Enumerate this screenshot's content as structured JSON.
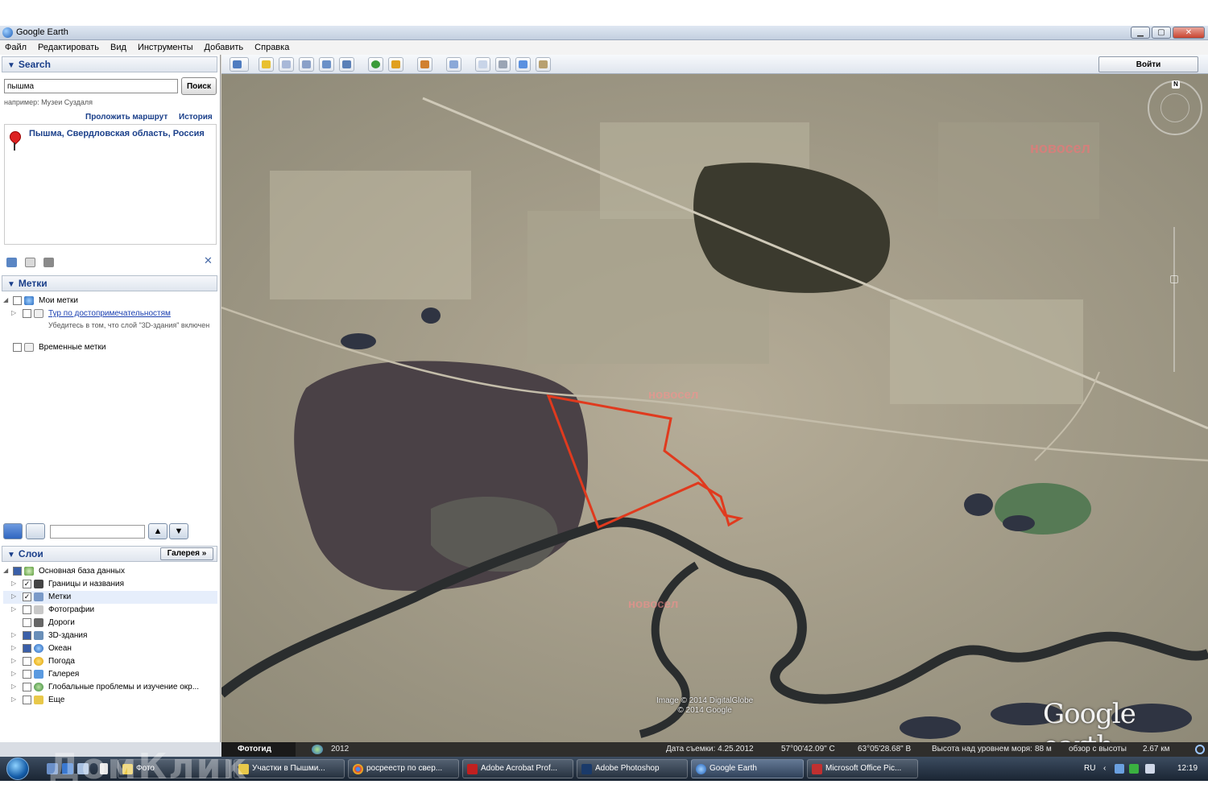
{
  "window": {
    "title": "Google Earth",
    "buttons": [
      "▁",
      "▢",
      "✕"
    ]
  },
  "menu": [
    "Файл",
    "Редактировать",
    "Вид",
    "Инструменты",
    "Добавить",
    "Справка"
  ],
  "search": {
    "header": "Search",
    "value": "пышма",
    "button": "Поиск",
    "hint": "например: Музеи Суздаля",
    "route_link": "Проложить маршрут",
    "history_link": "История",
    "result": "Пышма, Свердловская область, Россия"
  },
  "places": {
    "header": "Метки",
    "my_places": "Мои метки",
    "tour": "Тур по достопримечательностям",
    "tour_note": "Убедитесь в том, что слой \"3D-здания\" включен",
    "temp": "Временные метки"
  },
  "layers": {
    "header": "Слои",
    "gallery_button": "Галерея »",
    "items": [
      "Основная база данных",
      "Границы и названия",
      "Метки",
      "Фотографии",
      "Дороги",
      "3D-здания",
      "Океан",
      "Погода",
      "Галерея",
      "Глобальные проблемы и изучение окр...",
      "Еще"
    ]
  },
  "toolbar": {
    "signin": "Войти"
  },
  "map": {
    "compass_n": "N",
    "watermark": "новосел",
    "copyright_1": "Image © 2014 DigitalGlobe",
    "copyright_2": "© 2014 Google",
    "logo": "Google earth"
  },
  "status": {
    "tab": "Фотогид",
    "year": "2012",
    "date": "Дата съемки: 4.25.2012",
    "lat": "57°00'42.09\" С",
    "lon": "63°05'28.68\" В",
    "elev_label": "Высота над уровнем моря:",
    "elev": "88 м",
    "eye_label": "обзор с высоты",
    "eye": "2.67 км"
  },
  "taskbar": {
    "tasks": [
      "Фото",
      "Участки в Пышми...",
      "росреестр по свер...",
      "Adobe Acrobat Prof...",
      "Adobe Photoshop",
      "Google Earth",
      "Microsoft Office Pic..."
    ],
    "lang": "RU",
    "time": "12:19"
  },
  "overlay": {
    "domclick": "ДомКлик"
  }
}
